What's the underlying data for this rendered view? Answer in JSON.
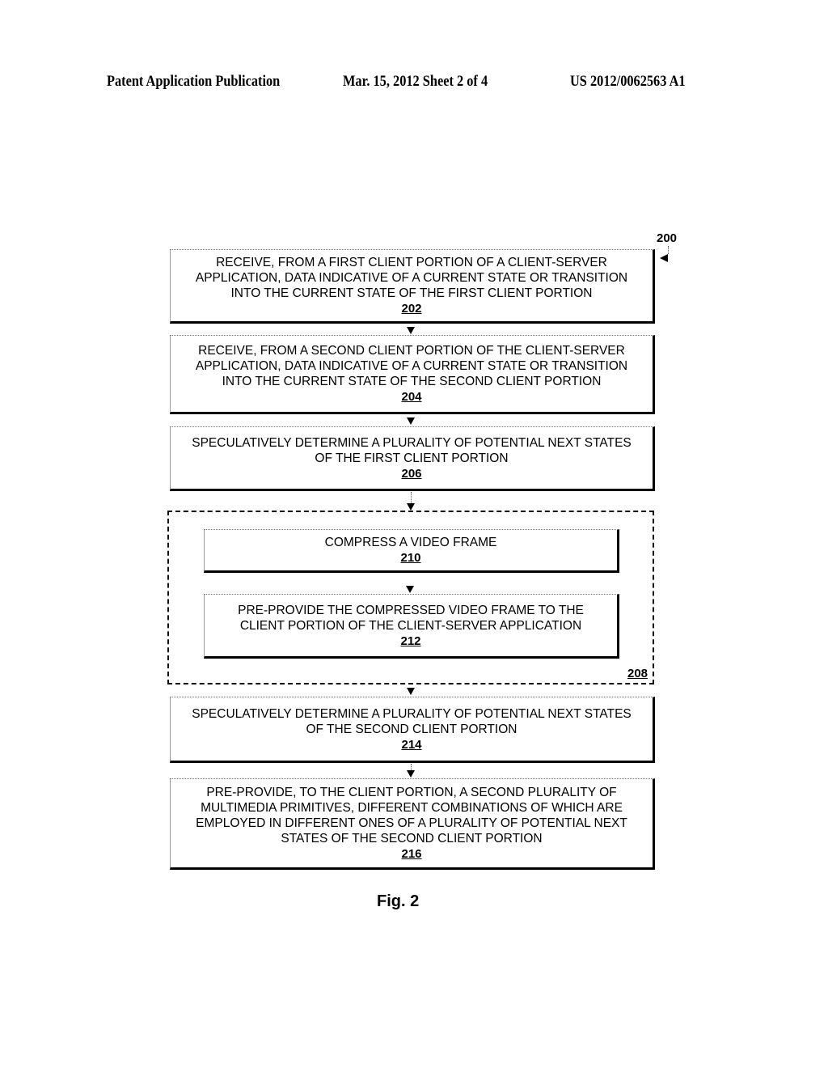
{
  "header": {
    "publication": "Patent Application Publication",
    "date_sheet": "Mar. 15, 2012  Sheet 2 of 4",
    "pub_number": "US 2012/0062563 A1"
  },
  "diagram": {
    "ref": "200",
    "steps": [
      {
        "text": "RECEIVE, FROM A FIRST CLIENT PORTION OF A CLIENT-SERVER\nAPPLICATION, DATA INDICATIVE OF A CURRENT STATE OR TRANSITION\nINTO THE CURRENT STATE OF THE FIRST CLIENT PORTION",
        "ref": "202"
      },
      {
        "text": "RECEIVE, FROM A SECOND CLIENT PORTION OF THE CLIENT-SERVER\nAPPLICATION, DATA INDICATIVE OF A CURRENT STATE OR TRANSITION\nINTO THE CURRENT STATE OF THE SECOND CLIENT PORTION",
        "ref": "204"
      },
      {
        "text": "SPECULATIVELY DETERMINE A PLURALITY OF POTENTIAL NEXT STATES\nOF THE FIRST CLIENT PORTION",
        "ref": "206"
      },
      {
        "text": "COMPRESS A VIDEO FRAME",
        "ref": "210"
      },
      {
        "text": "PRE-PROVIDE THE COMPRESSED VIDEO FRAME TO THE\nCLIENT PORTION OF THE CLIENT-SERVER APPLICATION",
        "ref": "212"
      },
      {
        "text": "SPECULATIVELY DETERMINE A PLURALITY OF POTENTIAL NEXT STATES\nOF THE SECOND CLIENT PORTION",
        "ref": "214"
      },
      {
        "text": "PRE-PROVIDE, TO THE CLIENT PORTION, A SECOND PLURALITY OF\nMULTIMEDIA PRIMITIVES, DIFFERENT COMBINATIONS OF WHICH ARE\nEMPLOYED IN DIFFERENT ONES OF A PLURALITY OF POTENTIAL NEXT\nSTATES OF THE SECOND CLIENT PORTION",
        "ref": "216"
      }
    ],
    "group_ref": "208",
    "figure_label": "Fig. 2"
  }
}
